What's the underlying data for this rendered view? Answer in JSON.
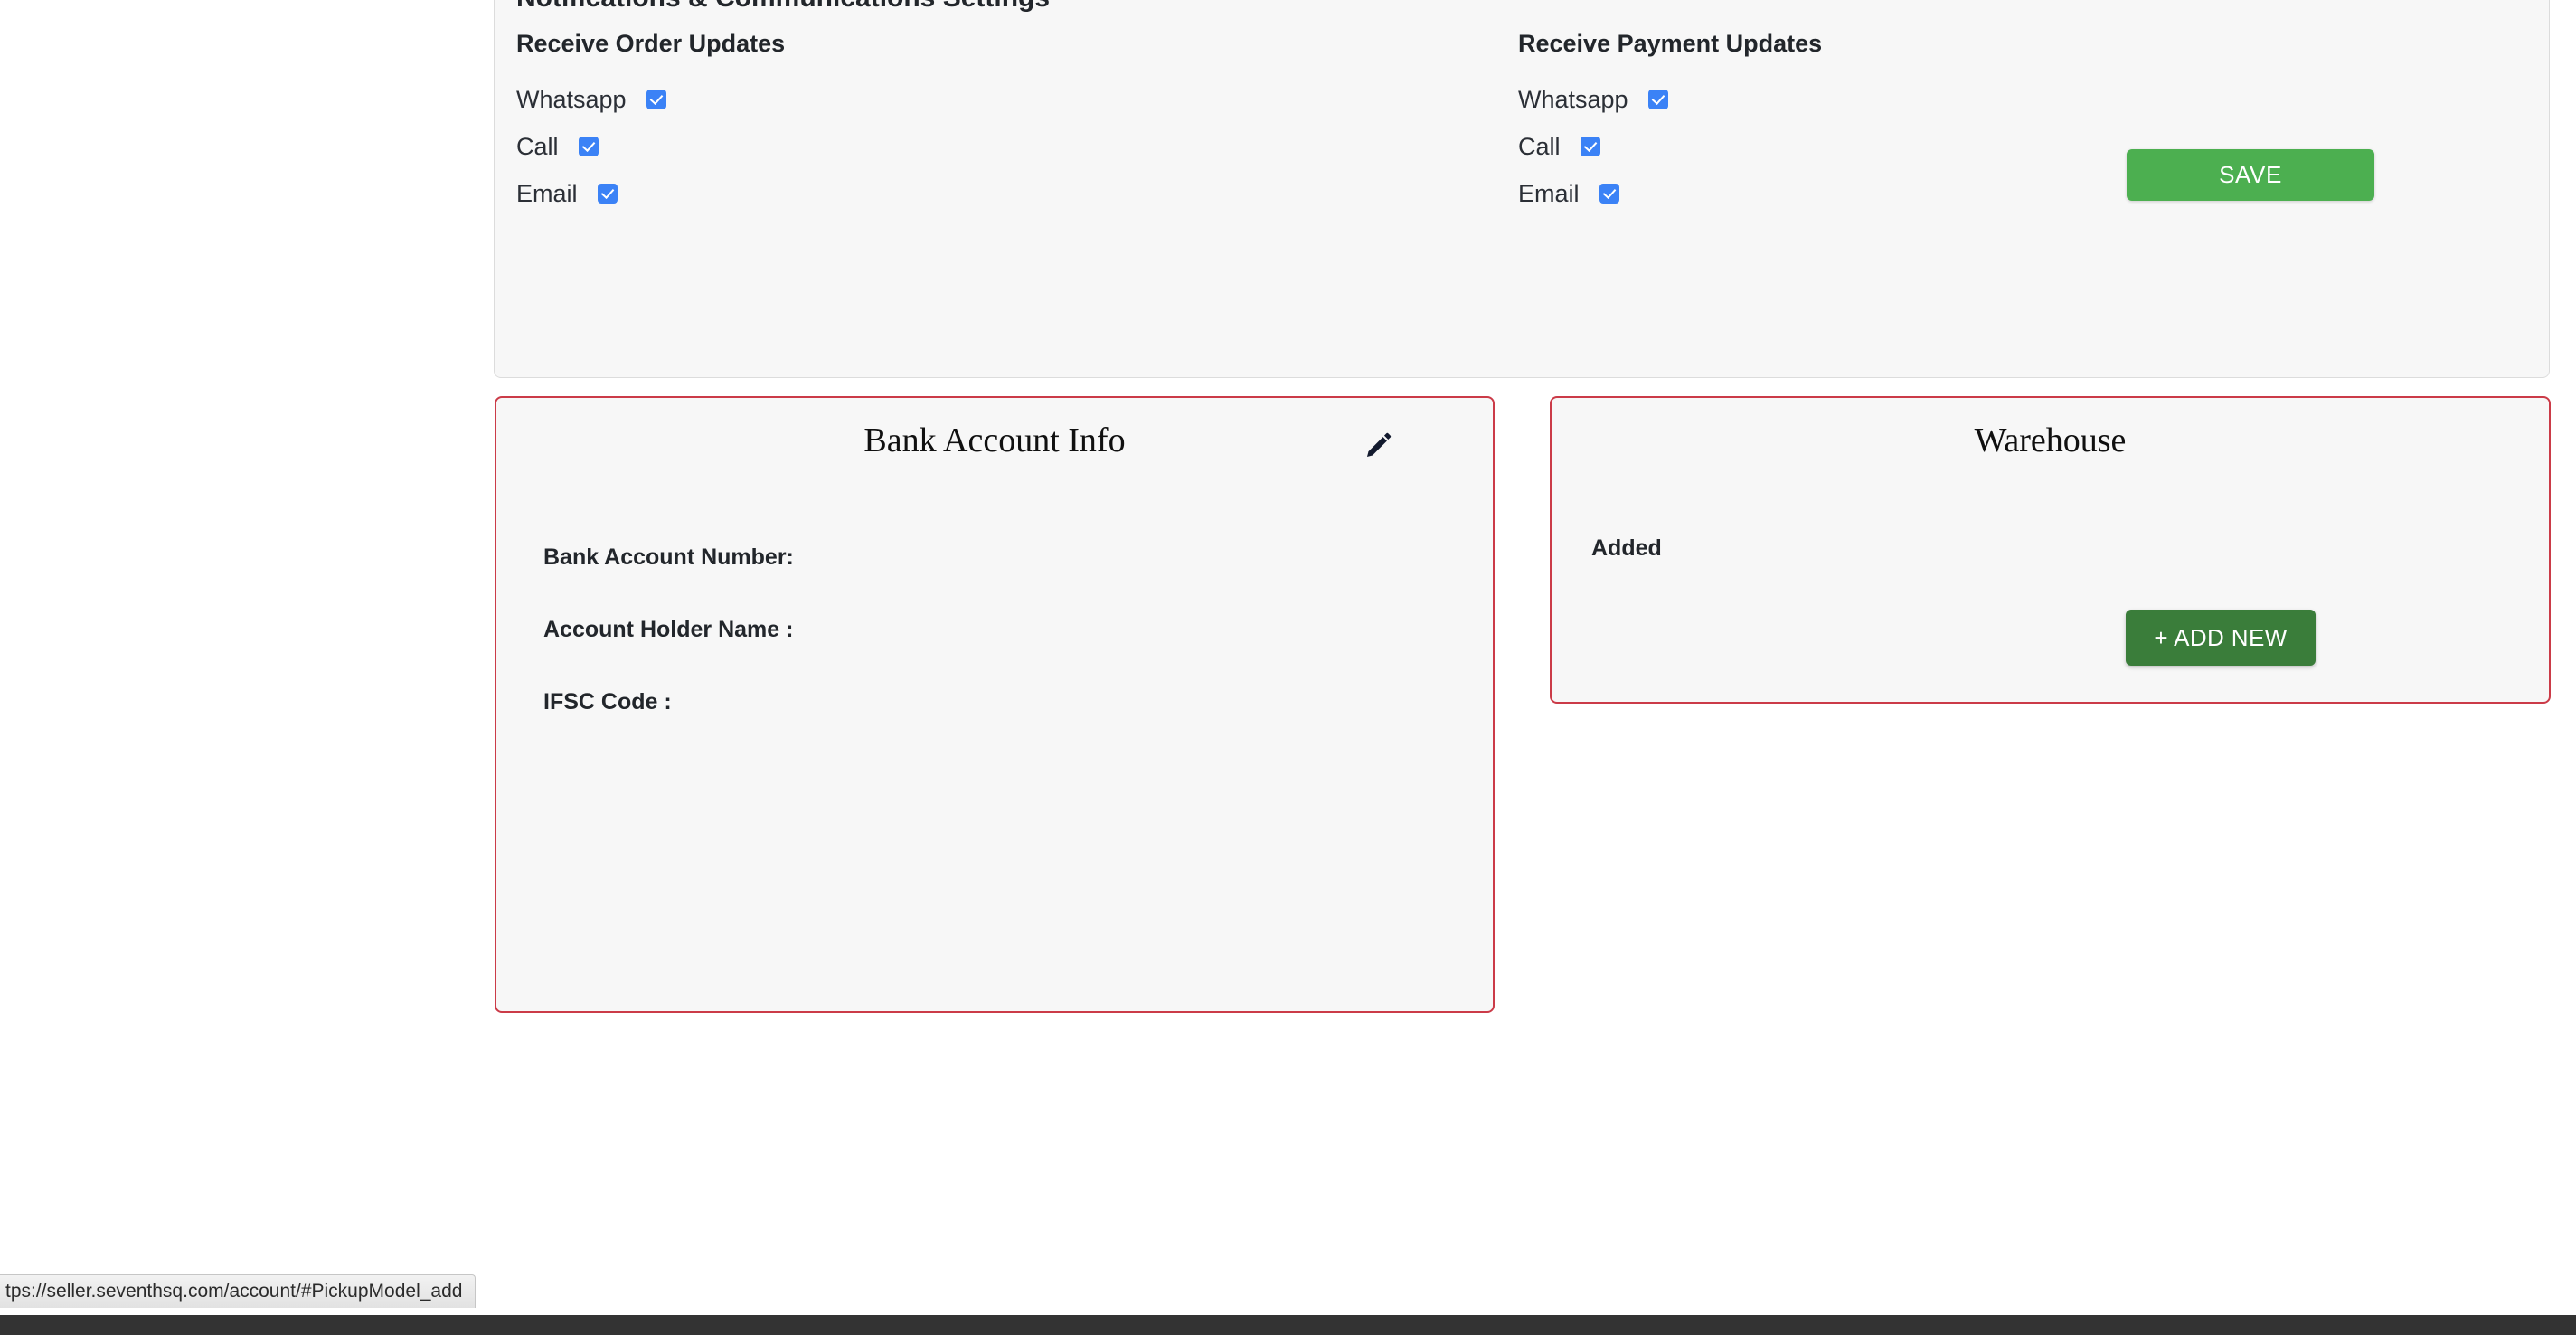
{
  "settings_panel": {
    "title": "Notifications & Communications Settings",
    "columns": [
      {
        "heading": "Receive Order Updates",
        "options": [
          {
            "label": "Whatsapp",
            "checked": true
          },
          {
            "label": "Call",
            "checked": true
          },
          {
            "label": "Email",
            "checked": true
          }
        ]
      },
      {
        "heading": "Receive Payment Updates",
        "options": [
          {
            "label": "Whatsapp",
            "checked": true
          },
          {
            "label": "Call",
            "checked": true
          },
          {
            "label": "Email",
            "checked": true
          }
        ]
      }
    ],
    "save_label": "SAVE"
  },
  "bank_card": {
    "title": "Bank Account Info",
    "edit_icon": "pencil-icon",
    "fields": [
      {
        "label": "Bank Account Number:",
        "value": ""
      },
      {
        "label": "Account Holder Name :",
        "value": ""
      },
      {
        "label": "IFSC Code :",
        "value": ""
      }
    ]
  },
  "warehouse_card": {
    "title": "Warehouse",
    "status": "Added",
    "add_label": "+ ADD NEW"
  },
  "browser": {
    "status_url": "tps://seller.seventhsq.com/account/#PickupModel_add"
  },
  "colors": {
    "save_green": "#4caf50",
    "add_green": "#3a7d3a",
    "card_border_red": "#cb3b48",
    "checkbox_blue": "#3b82f6",
    "panel_bg": "#f7f7f7"
  }
}
